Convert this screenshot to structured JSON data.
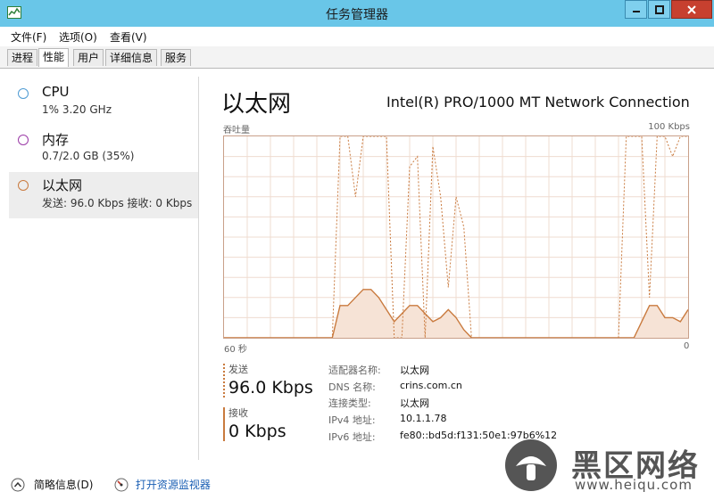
{
  "window": {
    "title": "任务管理器"
  },
  "menu": [
    "文件(F)",
    "选项(O)",
    "查看(V)"
  ],
  "tabs": [
    {
      "label": "进程",
      "active": false
    },
    {
      "label": "性能",
      "active": true
    },
    {
      "label": "用户",
      "active": false
    },
    {
      "label": "详细信息",
      "active": false
    },
    {
      "label": "服务",
      "active": false
    }
  ],
  "sidebar": {
    "items": [
      {
        "name": "CPU",
        "detail": "1% 3.20 GHz",
        "color": "#4f9bd3",
        "active": false
      },
      {
        "name": "内存",
        "detail": "0.7/2.0 GB (35%)",
        "color": "#9b3aa7",
        "active": false
      },
      {
        "name": "以太网",
        "detail": "发送: 96.0 Kbps 接收: 0 Kbps",
        "color": "#c97a3e",
        "active": true
      }
    ]
  },
  "panel": {
    "title": "以太网",
    "adapter_name": "Intel(R) PRO/1000 MT Network Connection",
    "graph_label_left": "吞吐量",
    "graph_label_right": "100 Kbps",
    "axis_left": "60 秒",
    "axis_right": "0",
    "send": {
      "label": "发送",
      "value": "96.0 Kbps",
      "color": "#c97a3e"
    },
    "receive": {
      "label": "接收",
      "value": "0 Kbps",
      "color": "#c97a3e"
    },
    "info": [
      {
        "key": "适配器名称:",
        "value": "以太网"
      },
      {
        "key": "DNS 名称:",
        "value": "crins.com.cn"
      },
      {
        "key": "连接类型:",
        "value": "以太网"
      },
      {
        "key": "IPv4 地址:",
        "value": "10.1.1.78"
      },
      {
        "key": "IPv6 地址:",
        "value": "fe80::bd5d:f131:50e1:97b6%12"
      }
    ]
  },
  "graph": {
    "x_max": 60,
    "y_max": 100,
    "send_series": [
      0,
      0,
      0,
      0,
      0,
      0,
      0,
      0,
      0,
      0,
      0,
      0,
      0,
      0,
      0,
      100,
      100,
      70,
      100,
      100,
      100,
      100,
      0,
      0,
      85,
      90,
      0,
      95,
      70,
      25,
      70,
      55,
      0,
      0,
      0,
      0,
      0,
      0,
      0,
      0,
      0,
      0,
      0,
      0,
      0,
      0,
      0,
      0,
      0,
      0,
      0,
      0,
      100,
      100,
      100,
      20,
      100,
      100,
      90,
      100,
      100
    ],
    "recv_series": [
      0,
      0,
      0,
      0,
      0,
      0,
      0,
      0,
      0,
      0,
      0,
      0,
      0,
      0,
      0,
      16,
      16,
      20,
      24,
      24,
      20,
      14,
      8,
      12,
      16,
      16,
      12,
      8,
      10,
      14,
      10,
      4,
      0,
      0,
      0,
      0,
      0,
      0,
      0,
      0,
      0,
      0,
      0,
      0,
      0,
      0,
      0,
      0,
      0,
      0,
      0,
      0,
      0,
      0,
      8,
      16,
      16,
      10,
      10,
      8,
      14
    ],
    "line_color": "#c97a3e",
    "fill_color": "#f6e3d6",
    "grid_color": "#efdcd0"
  },
  "footer": {
    "summary": "简略信息(D)",
    "monitor": "打开资源监视器"
  },
  "watermark": {
    "title": "黑区网络",
    "url": "www.heiqu.com"
  }
}
